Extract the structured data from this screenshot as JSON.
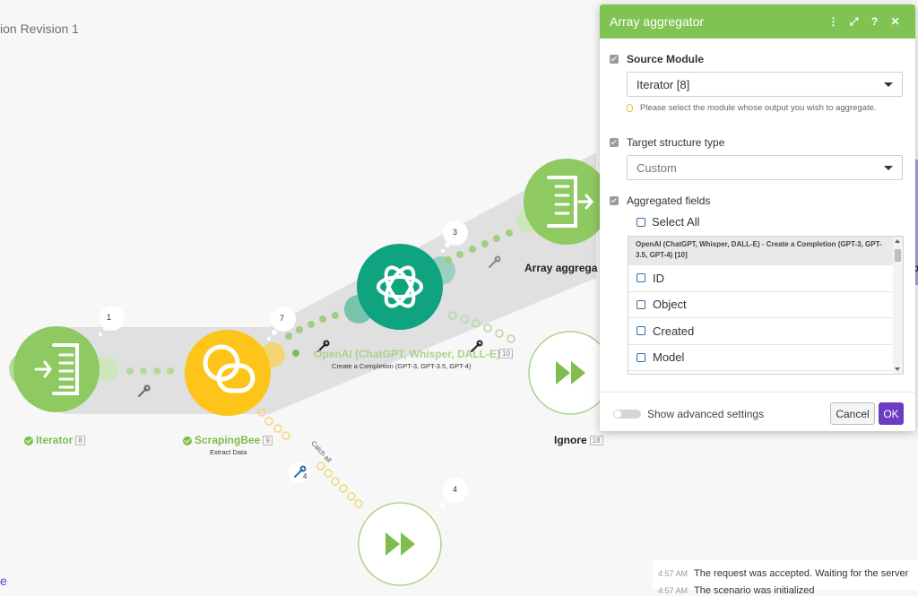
{
  "scenario": {
    "title": "ion Revision 1"
  },
  "modules": {
    "iterator": {
      "name": "Iterator",
      "id": "8",
      "badge": "1"
    },
    "scrapingbee": {
      "name": "ScrapingBee",
      "id": "9",
      "sub": "Extract Data",
      "badge": "7"
    },
    "openai": {
      "name": "OpenAI (ChatGPT, Whisper, DALL-E)",
      "id": "10",
      "sub": "Create a Completion (GPT-3, GPT-3.5, GPT-4)",
      "badge": "3"
    },
    "array_aggregator": {
      "name": "Array aggrega"
    },
    "ignore_main": {
      "name": "Ignore",
      "id": "18"
    },
    "ignore_catch": {
      "badge": "4",
      "route_label": "Catch all",
      "filter_id": "4"
    },
    "right_edge_label": "o"
  },
  "panel": {
    "title": "Array aggregator",
    "header_icons": [
      "more-vert-icon",
      "fullscreen-icon",
      "help-icon",
      "close-icon"
    ],
    "source_module": {
      "label": "Source Module",
      "value": "Iterator [8]",
      "hint": "Please select the module whose output you wish to aggregate."
    },
    "target_structure": {
      "label": "Target structure type",
      "value": "Custom"
    },
    "aggregated_fields": {
      "label": "Aggregated fields",
      "select_all": "Select All",
      "group_header": "OpenAI (ChatGPT, Whisper, DALL-E) - Create a Completion (GPT-3, GPT-3.5, GPT-4) [10]",
      "fields": [
        "ID",
        "Object",
        "Created",
        "Model"
      ]
    },
    "footer": {
      "advanced_label": "Show advanced settings",
      "cancel": "Cancel",
      "ok": "OK"
    }
  },
  "log": [
    {
      "time": "4:57 AM",
      "text": "The request was accepted. Waiting for the server"
    },
    {
      "time": "4:57 AM",
      "text": "The scenario was initialized"
    }
  ],
  "colors": {
    "green": "#7fc452",
    "yellow": "#fdc419",
    "openai": "#10a37f",
    "purple": "#6c3cc2"
  }
}
